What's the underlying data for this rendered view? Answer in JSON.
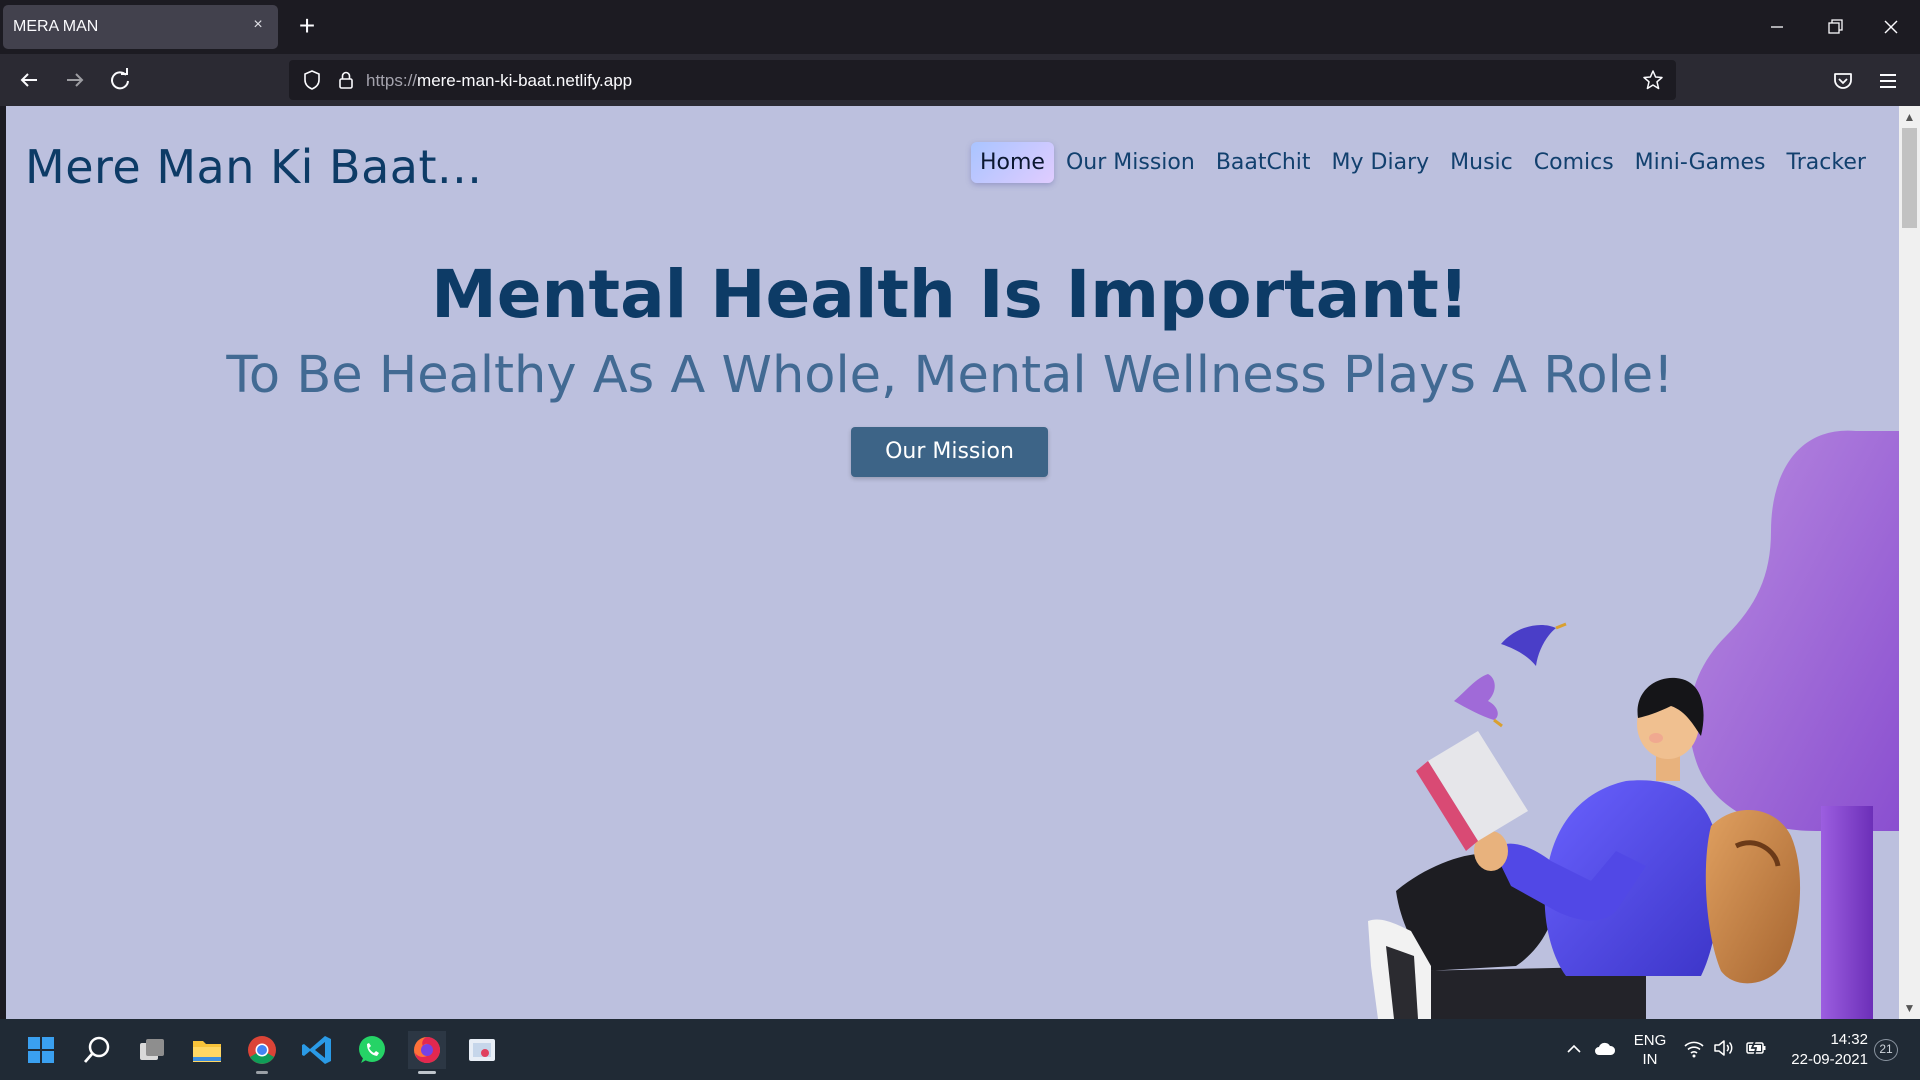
{
  "browser": {
    "tab_title": "MERA MAN",
    "tab_close_glyph": "×",
    "new_tab_glyph": "+",
    "url_protocol": "https://",
    "url_host": "mere-man-ki-baat.netlify.app"
  },
  "site": {
    "logo": "Mere Man Ki Baat...",
    "nav": [
      {
        "label": "Home",
        "active": true
      },
      {
        "label": "Our Mission",
        "active": false
      },
      {
        "label": "BaatChit",
        "active": false
      },
      {
        "label": "My Diary",
        "active": false
      },
      {
        "label": "Music",
        "active": false
      },
      {
        "label": "Comics",
        "active": false
      },
      {
        "label": "Mini-Games",
        "active": false
      },
      {
        "label": "Tracker",
        "active": false
      }
    ],
    "hero": {
      "title": "Mental Health Is Important!",
      "subtitle": "To Be Healthy As A Whole, Mental Wellness Plays A Role!",
      "button_label": "Our Mission"
    }
  },
  "taskbar": {
    "apps": [
      "start-icon",
      "search-icon",
      "task-view-icon",
      "file-explorer-icon",
      "chrome-icon",
      "vscode-icon",
      "whatsapp-icon",
      "firefox-icon",
      "snipping-tool-icon"
    ],
    "lang_line1": "ENG",
    "lang_line2": "IN",
    "time": "14:32",
    "date": "22-09-2021",
    "notification_count": "21"
  },
  "colors": {
    "page_bg": "#bcc0de",
    "heading": "#0d3b66",
    "subheading": "#426a93",
    "button_bg": "#3d6487"
  }
}
